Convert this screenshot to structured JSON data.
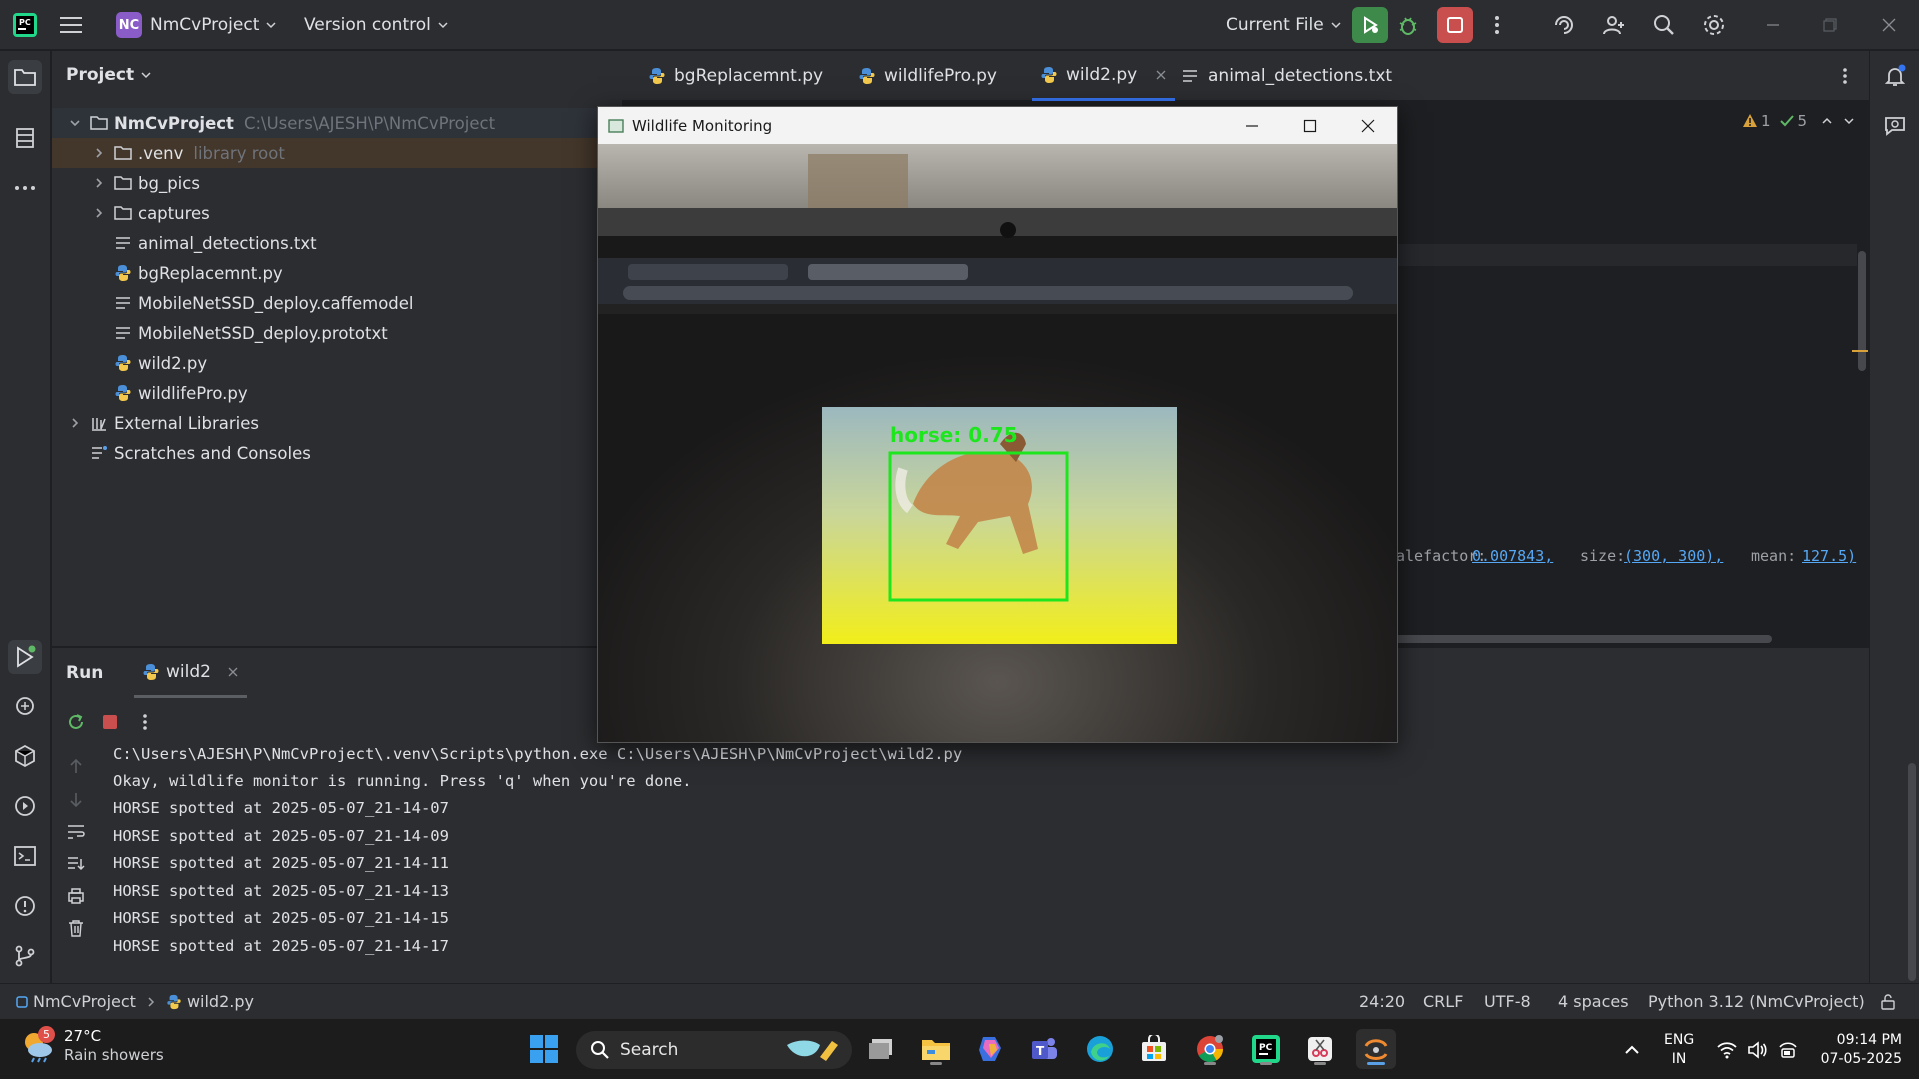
{
  "titlebar": {
    "project_badge": "NC",
    "project_name": "NmCvProject",
    "version_control": "Version control",
    "run_config": "Current File"
  },
  "project_panel": {
    "header": "Project",
    "tree": [
      {
        "label": "NmCvProject",
        "hint": "C:\\Users\\AJESH\\P\\NmCvProject",
        "type": "folder",
        "expanded": true
      },
      {
        "label": ".venv",
        "hint": "library root",
        "type": "folder"
      },
      {
        "label": "bg_pics",
        "hint": "",
        "type": "folder"
      },
      {
        "label": "captures",
        "hint": "",
        "type": "folder"
      },
      {
        "label": "animal_detections.txt",
        "hint": "",
        "type": "text"
      },
      {
        "label": "bgReplacemnt.py",
        "hint": "",
        "type": "python"
      },
      {
        "label": "MobileNetSSD_deploy.caffemodel",
        "hint": "",
        "type": "text"
      },
      {
        "label": "MobileNetSSD_deploy.prototxt",
        "hint": "",
        "type": "text"
      },
      {
        "label": "wild2.py",
        "hint": "",
        "type": "python"
      },
      {
        "label": "wildlifePro.py",
        "hint": "",
        "type": "python"
      },
      {
        "label": "External Libraries",
        "hint": "",
        "type": "library"
      },
      {
        "label": "Scratches and Consoles",
        "hint": "",
        "type": "scratch"
      }
    ]
  },
  "editor": {
    "tabs": [
      {
        "label": "bgReplacemnt.py",
        "active": false
      },
      {
        "label": "wildlifePro.py",
        "active": false
      },
      {
        "label": "wild2.py",
        "active": true
      },
      {
        "label": "animal_detections.txt",
        "active": false
      }
    ],
    "inspections": {
      "warnings": "1",
      "ok": "5"
    },
    "code_fragment": {
      "p1": "alefactor:",
      "v1": "0.007843,",
      "p2": "size:",
      "v2": "(300, 300),",
      "p3": "mean:",
      "v3": "127.5)"
    }
  },
  "run_panel": {
    "tab_run": "Run",
    "tab_config": "wild2",
    "console_lines": [
      "C:\\Users\\AJESH\\P\\NmCvProject\\.venv\\Scripts\\python.exe C:\\Users\\AJESH\\P\\NmCvProject\\wild2.py",
      "Okay, wildlife monitor is running. Press 'q' when you're done.",
      "HORSE spotted at 2025-05-07_21-14-07",
      "HORSE spotted at 2025-05-07_21-14-09",
      "HORSE spotted at 2025-05-07_21-14-11",
      "HORSE spotted at 2025-05-07_21-14-13",
      "HORSE spotted at 2025-05-07_21-14-15",
      "HORSE spotted at 2025-05-07_21-14-17"
    ]
  },
  "popup": {
    "title": "Wildlife Monitoring",
    "detection_label": "horse: 0.75"
  },
  "statusbar": {
    "crumb_project": "NmCvProject",
    "crumb_file": "wild2.py",
    "position": "24:20",
    "line_sep": "CRLF",
    "encoding": "UTF-8",
    "indent": "4 spaces",
    "interpreter": "Python 3.12 (NmCvProject)"
  },
  "taskbar": {
    "weather_temp": "27°C",
    "weather_desc": "Rain showers",
    "weather_badge": "5",
    "search": "Search",
    "lang": "ENG",
    "region": "IN",
    "time": "09:14 PM",
    "date": "07-05-2025"
  },
  "colors": {
    "accent": "#3574f0",
    "run_green": "#3d8a4a",
    "stop_red": "#c94f4f",
    "detection_green": "#1ee61e"
  }
}
